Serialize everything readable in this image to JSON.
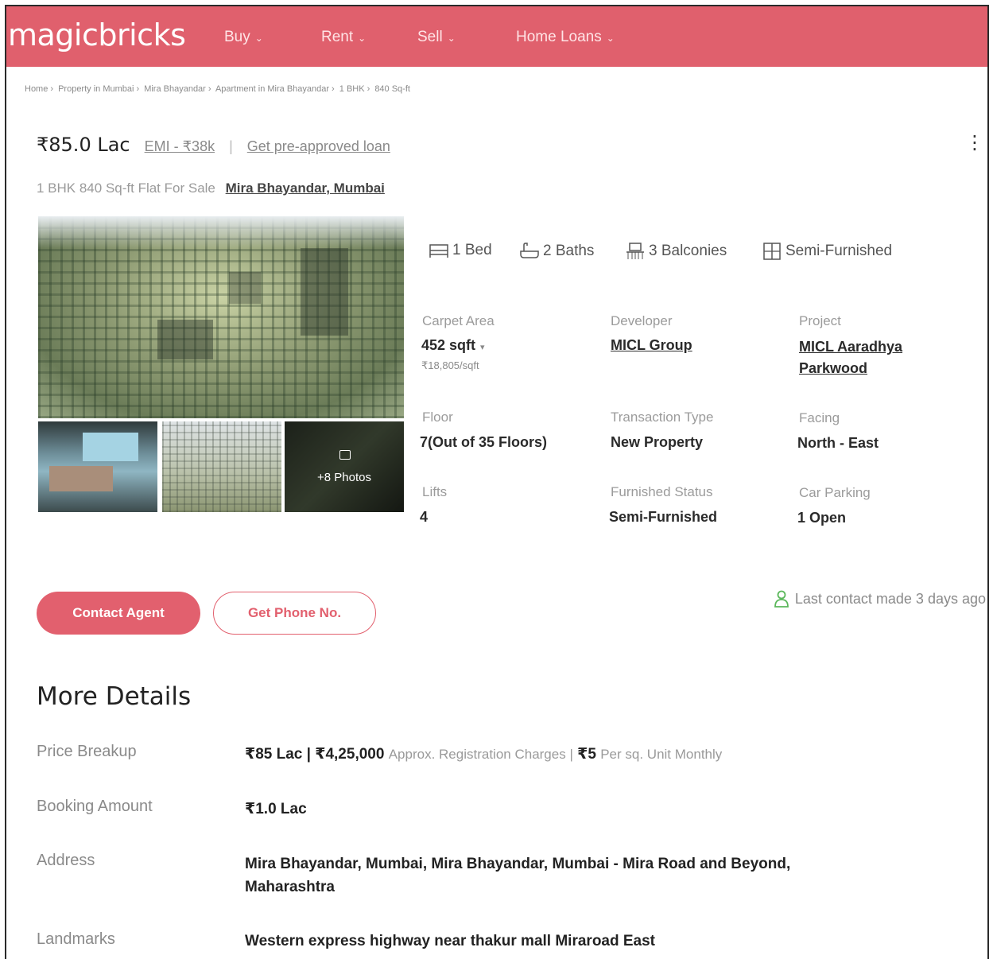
{
  "header": {
    "logo": "magicbricks",
    "nav": [
      {
        "label": "Buy"
      },
      {
        "label": "Rent"
      },
      {
        "label": "Sell"
      },
      {
        "label": "Home Loans"
      }
    ]
  },
  "breadcrumb": [
    "Home",
    "Property in Mumbai",
    "Mira Bhayandar",
    "Apartment in Mira Bhayandar",
    "1 BHK",
    "840 Sq-ft"
  ],
  "listing": {
    "price": "₹85.0 Lac",
    "emi": "EMI - ₹38k",
    "preapproved": "Get pre-approved loan",
    "subtitle": "1 BHK 840 Sq-ft Flat For Sale",
    "location": "Mira Bhayandar, Mumbai",
    "photos_more": "+8 Photos"
  },
  "amenities": {
    "bed": "1 Bed",
    "baths": "2 Baths",
    "balconies": "3 Balconies",
    "furnishing": "Semi-Furnished"
  },
  "specs": {
    "carpet_label": "Carpet Area",
    "carpet_value": "452 sqft",
    "carpet_rate": "₹18,805/sqft",
    "developer_label": "Developer",
    "developer_value": "MICL Group",
    "project_label": "Project",
    "project_value_line1": "MICL Aaradhya",
    "project_value_line2": "Parkwood",
    "floor_label": "Floor",
    "floor_value": "7(Out of 35 Floors)",
    "transaction_label": "Transaction Type",
    "transaction_value": "New Property",
    "facing_label": "Facing",
    "facing_value": "North - East",
    "lifts_label": "Lifts",
    "lifts_value": "4",
    "furnished_label": "Furnished Status",
    "furnished_value": "Semi-Furnished",
    "parking_label": "Car Parking",
    "parking_value": "1 Open"
  },
  "actions": {
    "contact": "Contact Agent",
    "phone": "Get Phone No.",
    "last_contact": "Last contact made 3 days ago"
  },
  "more_details": {
    "title": "More Details",
    "price_breakup_label": "Price Breakup",
    "price_breakup_value": "₹85 Lac | ₹4,25,000",
    "price_breakup_note1": "Approx. Registration Charges |",
    "price_breakup_value2": "₹5",
    "price_breakup_note2": "Per sq. Unit Monthly",
    "booking_label": "Booking Amount",
    "booking_value": "₹1.0 Lac",
    "address_label": "Address",
    "address_line1": "Mira Bhayandar, Mumbai, Mira Bhayandar, Mumbai - Mira Road and Beyond,",
    "address_line2": "Maharashtra",
    "landmarks_label": "Landmarks",
    "landmarks_value": "Western express highway near thakur mall Miraroad East"
  },
  "colors": {
    "brand": "#e0606d",
    "accent_icon": "#5cb85c"
  }
}
